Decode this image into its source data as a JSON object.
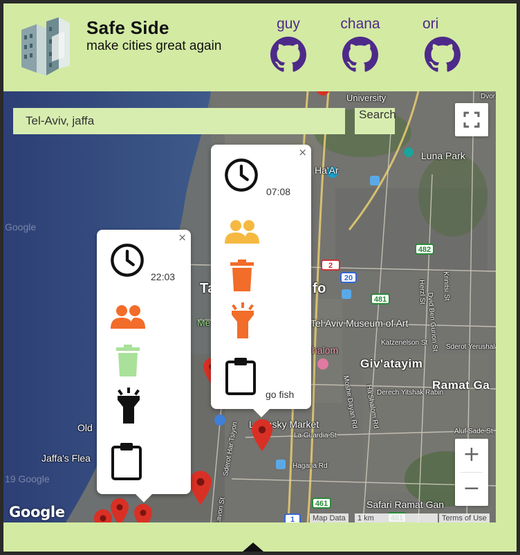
{
  "header": {
    "title": "Safe Side",
    "subtitle": "make cities great again"
  },
  "developers": [
    {
      "name": "guy",
      "icon": "github-icon"
    },
    {
      "name": "chana",
      "icon": "github-icon"
    },
    {
      "name": "ori",
      "icon": "github-icon"
    }
  ],
  "search": {
    "value": "Tel-Aviv, jaffa",
    "button_label": "Search"
  },
  "map": {
    "labels": [
      "University",
      "Luna Park",
      "Tel Aviv Museum of Art",
      "Giv'atayim",
      "Ramat Ga",
      "Levinsky Market",
      "Old",
      "Jaffa's Flea",
      "Safari Ramat Gan",
      "Ha'Ar",
      "Me",
      "Ta",
      "fo",
      "halom",
      "La Guardia St",
      "Hagana Rd",
      "Derech Yitshak Rabin",
      "Katzenelson St",
      "Sderot Yerushala",
      "Dvora",
      "Dvid Ben Gurion St",
      "Herzl St",
      "Krinitsi St",
      "Ha'Shalom Rd",
      "Moshe Dayan Rd",
      "Aluf Sade St",
      "Sderot Har Tsiyon",
      "Lavon St",
      "Google",
      "Google",
      "19 Google"
    ],
    "road_badges": [
      "2",
      "20",
      "481",
      "482",
      "461",
      "1",
      "461"
    ],
    "google_logo": "Google",
    "attribution": [
      "Map Data",
      "1 km",
      "Terms of Use"
    ],
    "zoom_in": "+",
    "zoom_out": "−"
  },
  "info_windows": [
    {
      "id": "left",
      "time": "22:03",
      "note": "",
      "close": "×",
      "icons": {
        "people": "#f26c2a",
        "trash": "#a9e19a",
        "flashlight": "#111111",
        "clipboard": "#111111"
      }
    },
    {
      "id": "right",
      "time": "07:08",
      "note": "go fish",
      "close": "×",
      "icons": {
        "people": "#f5b942",
        "trash": "#f26c2a",
        "flashlight": "#f26c2a",
        "clipboard": "#111111"
      }
    }
  ],
  "colors": {
    "page_bg": "#d3eaa3",
    "accent_purple": "#4d2a8a",
    "pin_red": "#d93025"
  }
}
